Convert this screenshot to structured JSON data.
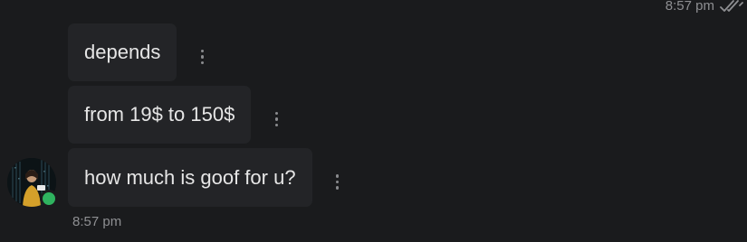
{
  "outgoing": {
    "time": "8:57 pm",
    "status_icon": "double-check-icon"
  },
  "messages": [
    {
      "text": "depends"
    },
    {
      "text": "from 19$ to 150$"
    },
    {
      "text": "how much is goof for u?"
    }
  ],
  "incoming": {
    "time": "8:57 pm",
    "avatar_icon": "user-avatar",
    "presence": "online",
    "presence_color": "#2fb35f"
  },
  "colors": {
    "background": "#1a1b1d",
    "bubble": "#232427",
    "text": "#e6e6e6",
    "muted": "#8e8f92"
  }
}
